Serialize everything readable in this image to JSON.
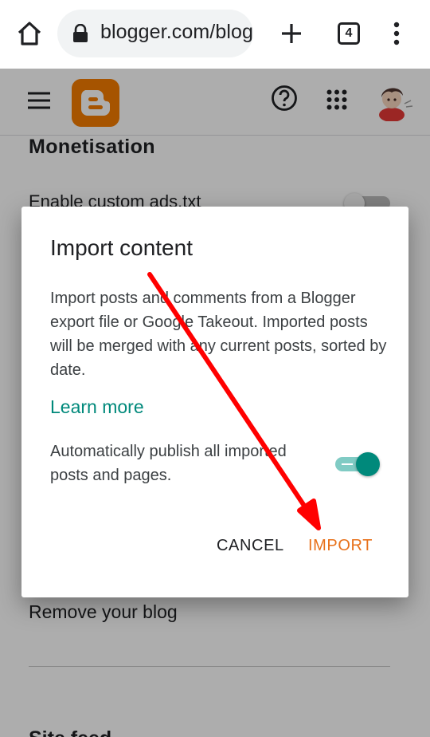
{
  "browser": {
    "url": "blogger.com/blog",
    "tab_count": "4",
    "icons": [
      "home-icon",
      "lock-icon",
      "new-tab-icon",
      "tab-switcher-icon",
      "more-vert-icon"
    ]
  },
  "app_bar": {
    "icons": [
      "menu-icon",
      "blogger-logo",
      "help-icon",
      "apps-icon",
      "avatar"
    ],
    "brand_color": "#f57d00"
  },
  "page": {
    "section_title": "Monetisation",
    "row_custom_ads": "Enable custom ads.txt",
    "remove_blog": "Remove your blog",
    "next_section": "Site feed"
  },
  "dialog": {
    "title": "Import content",
    "body": "Import posts and comments from a Blogger export file or Google Takeout. Imported posts will be merged with any current posts, sorted by date.",
    "learn_more": "Learn more",
    "publish_label": "Automatically publish all imported posts and pages.",
    "publish_enabled": true,
    "cancel_label": "CANCEL",
    "import_label": "IMPORT"
  },
  "colors": {
    "accent_teal": "#00897b",
    "import_orange": "#e8711a",
    "arrow_red": "#ff0000"
  }
}
